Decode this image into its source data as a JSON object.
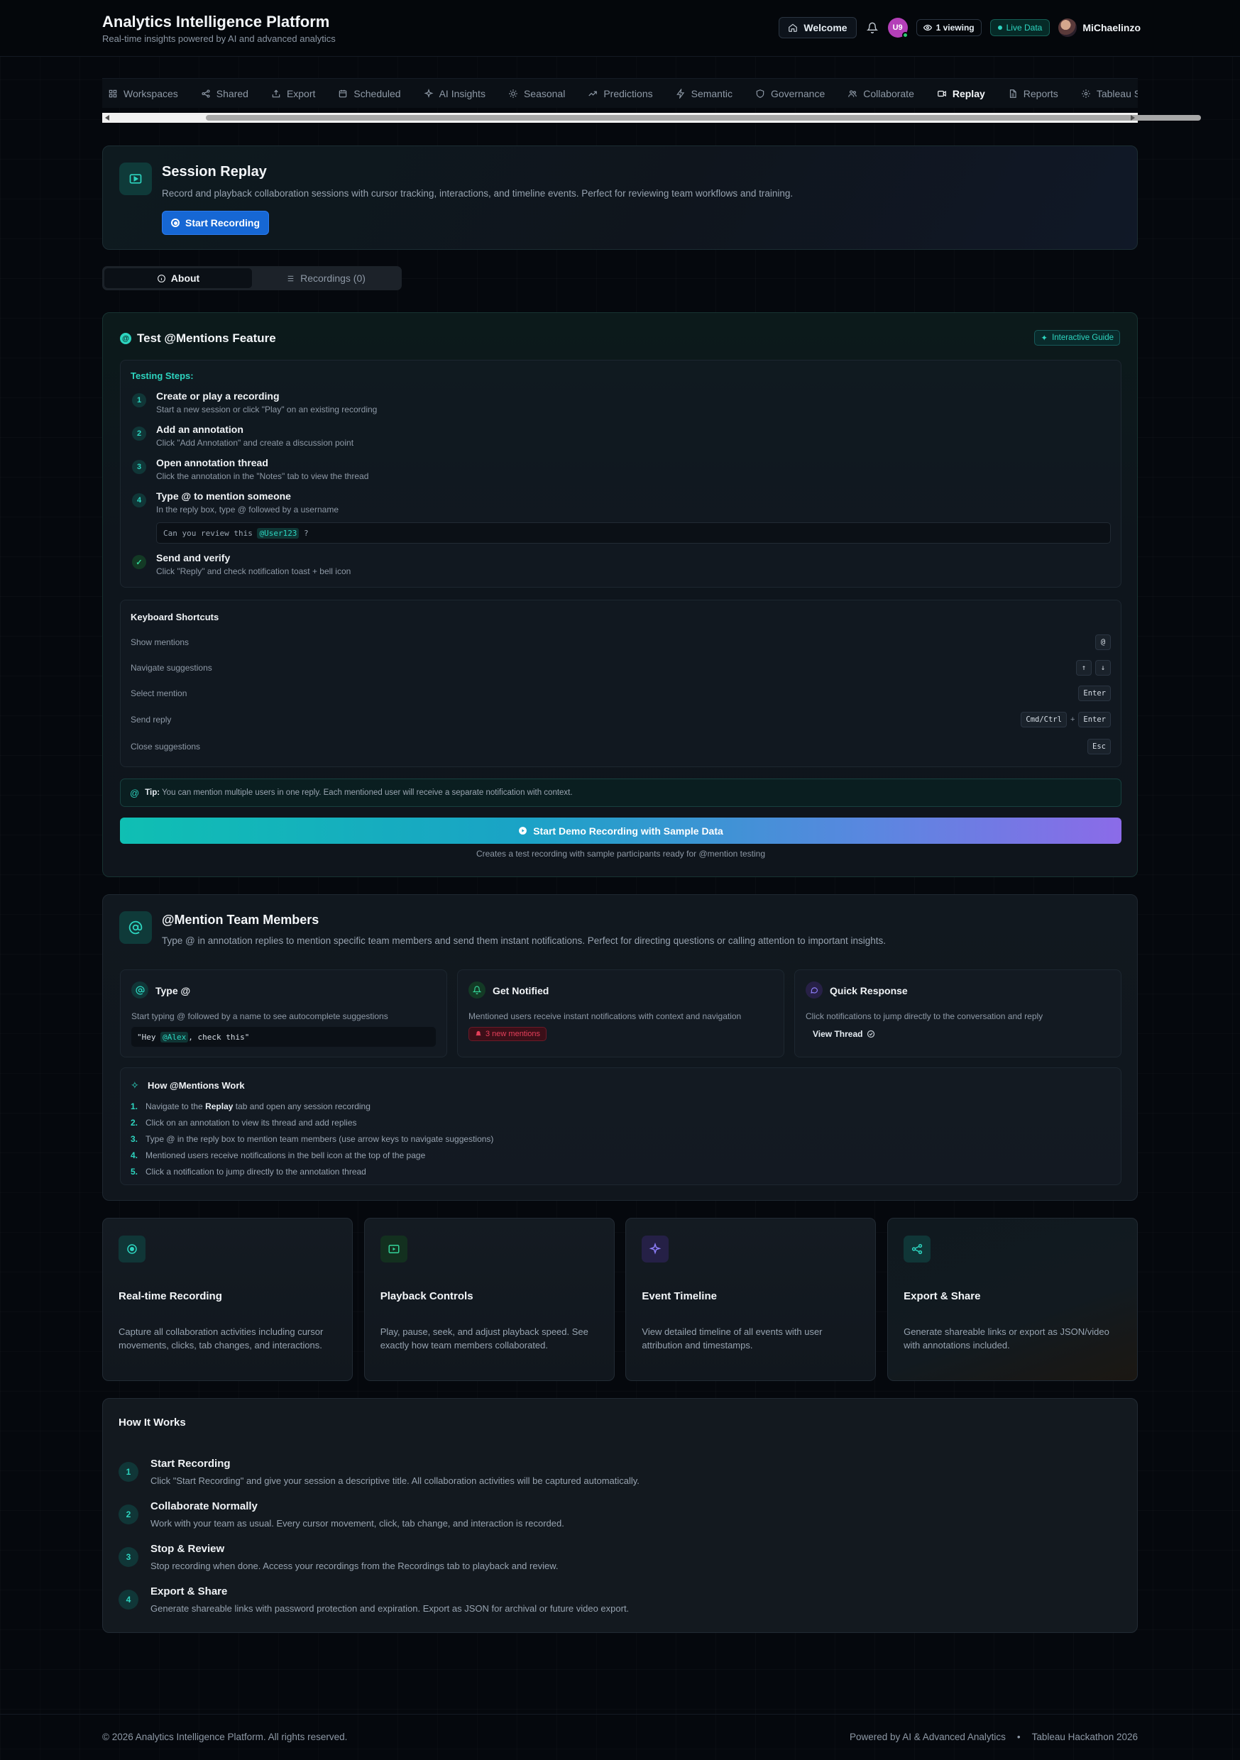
{
  "header": {
    "title": "Analytics Intelligence Platform",
    "subtitle": "Real-time insights powered by AI and advanced analytics",
    "welcome_label": "Welcome",
    "avatar_initials": "U9",
    "viewing_label": "1 viewing",
    "live_label": "Live Data",
    "user_name": "MiChaelinzo"
  },
  "tabs": [
    {
      "label": "Workspaces",
      "icon": "grid-icon"
    },
    {
      "label": "Shared",
      "icon": "share-icon"
    },
    {
      "label": "Export",
      "icon": "export-icon"
    },
    {
      "label": "Scheduled",
      "icon": "calendar-icon"
    },
    {
      "label": "AI Insights",
      "icon": "sparkle-icon"
    },
    {
      "label": "Seasonal",
      "icon": "sun-icon"
    },
    {
      "label": "Predictions",
      "icon": "trend-icon"
    },
    {
      "label": "Semantic",
      "icon": "bolt-icon"
    },
    {
      "label": "Governance",
      "icon": "shield-icon"
    },
    {
      "label": "Collaborate",
      "icon": "users-icon"
    },
    {
      "label": "Replay",
      "icon": "video-icon",
      "active": true
    },
    {
      "label": "Reports",
      "icon": "file-icon"
    },
    {
      "label": "Tableau Se",
      "icon": "gear-icon"
    }
  ],
  "session_replay": {
    "title": "Session Replay",
    "description": "Record and playback collaboration sessions with cursor tracking, interactions, and timeline events. Perfect for reviewing team workflows and training.",
    "record_button": "Start Recording"
  },
  "subtabs": {
    "about": "About",
    "recordings": "Recordings (0)"
  },
  "mentions_feature": {
    "title": "Test @Mentions Feature",
    "badge": "Interactive Guide",
    "steps_heading": "Testing Steps:",
    "steps": [
      {
        "num": "1",
        "title": "Create or play a recording",
        "desc": "Start a new session or click \"Play\" on an existing recording"
      },
      {
        "num": "2",
        "title": "Add an annotation",
        "desc": "Click \"Add Annotation\" and create a discussion point"
      },
      {
        "num": "3",
        "title": "Open annotation thread",
        "desc": "Click the annotation in the \"Notes\" tab to view the thread"
      },
      {
        "num": "4",
        "title": "Type @ to mention someone",
        "desc": "In the reply box, type @ followed by a username"
      },
      {
        "num": "✓",
        "title": "Send and verify",
        "desc": "Click \"Reply\" and check notification toast + bell icon"
      }
    ],
    "example_prefix": "Can you review this ",
    "example_mention": "@User123",
    "example_suffix": " ?",
    "shortcuts_heading": "Keyboard Shortcuts",
    "shortcuts": [
      {
        "label": "Show mentions",
        "keys": [
          "@"
        ]
      },
      {
        "label": "Navigate suggestions",
        "keys": [
          "↑",
          "↓"
        ]
      },
      {
        "label": "Select mention",
        "keys": [
          "Enter"
        ]
      },
      {
        "label": "Send reply",
        "keys": [
          "Cmd/Ctrl",
          "+",
          "Enter"
        ]
      },
      {
        "label": "Close suggestions",
        "keys": [
          "Esc"
        ]
      }
    ],
    "tip_label": "Tip:",
    "tip_text": " You can mention multiple users in one reply. Each mentioned user will receive a separate notification with context.",
    "demo_button": "Start Demo Recording with Sample Data",
    "demo_note": "Creates a test recording with sample participants ready for @mention testing"
  },
  "team_mentions": {
    "title": "@Mention Team Members",
    "description": "Type @ in annotation replies to mention specific team members and send them instant notifications. Perfect for directing questions or calling attention to important insights.",
    "cards": [
      {
        "title": "Type @",
        "desc": "Start typing @ followed by a name to see autocomplete suggestions",
        "code_prefix": "\"Hey ",
        "code_mention": "@Alex",
        "code_suffix": ", check this\""
      },
      {
        "title": "Get Notified",
        "desc": "Mentioned users receive instant notifications with context and navigation",
        "badge": "3 new mentions"
      },
      {
        "title": "Quick Response",
        "desc": "Click notifications to jump directly to the conversation and reply",
        "link": "View Thread"
      }
    ],
    "how_heading": "How @Mentions Work",
    "how_steps": [
      {
        "n": "1.",
        "pre": "Navigate to the ",
        "bold": "Replay",
        "post": " tab and open any session recording"
      },
      {
        "n": "2.",
        "pre": "Click on an annotation to view its thread and add replies",
        "bold": "",
        "post": ""
      },
      {
        "n": "3.",
        "pre": "Type @ in the reply box to mention team members (use arrow keys to navigate suggestions)",
        "bold": "",
        "post": ""
      },
      {
        "n": "4.",
        "pre": "Mentioned users receive notifications in the bell icon at the top of the page",
        "bold": "",
        "post": ""
      },
      {
        "n": "5.",
        "pre": "Click a notification to jump directly to the annotation thread",
        "bold": "",
        "post": ""
      }
    ]
  },
  "features": [
    {
      "title": "Real-time Recording",
      "desc": "Capture all collaboration activities including cursor movements, clicks, tab changes, and interactions.",
      "color": "#2dd4bf"
    },
    {
      "title": "Playback Controls",
      "desc": "Play, pause, seek, and adjust playback speed. See exactly how team members collaborated.",
      "color": "#34d399"
    },
    {
      "title": "Event Timeline",
      "desc": "View detailed timeline of all events with user attribution and timestamps.",
      "color": "#8b7cf6"
    },
    {
      "title": "Export & Share",
      "desc": "Generate shareable links or export as JSON/video with annotations included.",
      "color": "#2dd4bf"
    }
  ],
  "how_it_works": {
    "title": "How It Works",
    "steps": [
      {
        "num": "1",
        "title": "Start Recording",
        "desc": "Click \"Start Recording\" and give your session a descriptive title. All collaboration activities will be captured automatically."
      },
      {
        "num": "2",
        "title": "Collaborate Normally",
        "desc": "Work with your team as usual. Every cursor movement, click, tab change, and interaction is recorded."
      },
      {
        "num": "3",
        "title": "Stop & Review",
        "desc": "Stop recording when done. Access your recordings from the Recordings tab to playback and review."
      },
      {
        "num": "4",
        "title": "Export & Share",
        "desc": "Generate shareable links with password protection and expiration. Export as JSON for archival or future video export."
      }
    ]
  },
  "footer": {
    "copyright": "© 2026 Analytics Intelligence Platform. All rights reserved.",
    "powered": "Powered by AI & Advanced Analytics",
    "separator": "•",
    "event": "Tableau Hackathon 2026"
  }
}
